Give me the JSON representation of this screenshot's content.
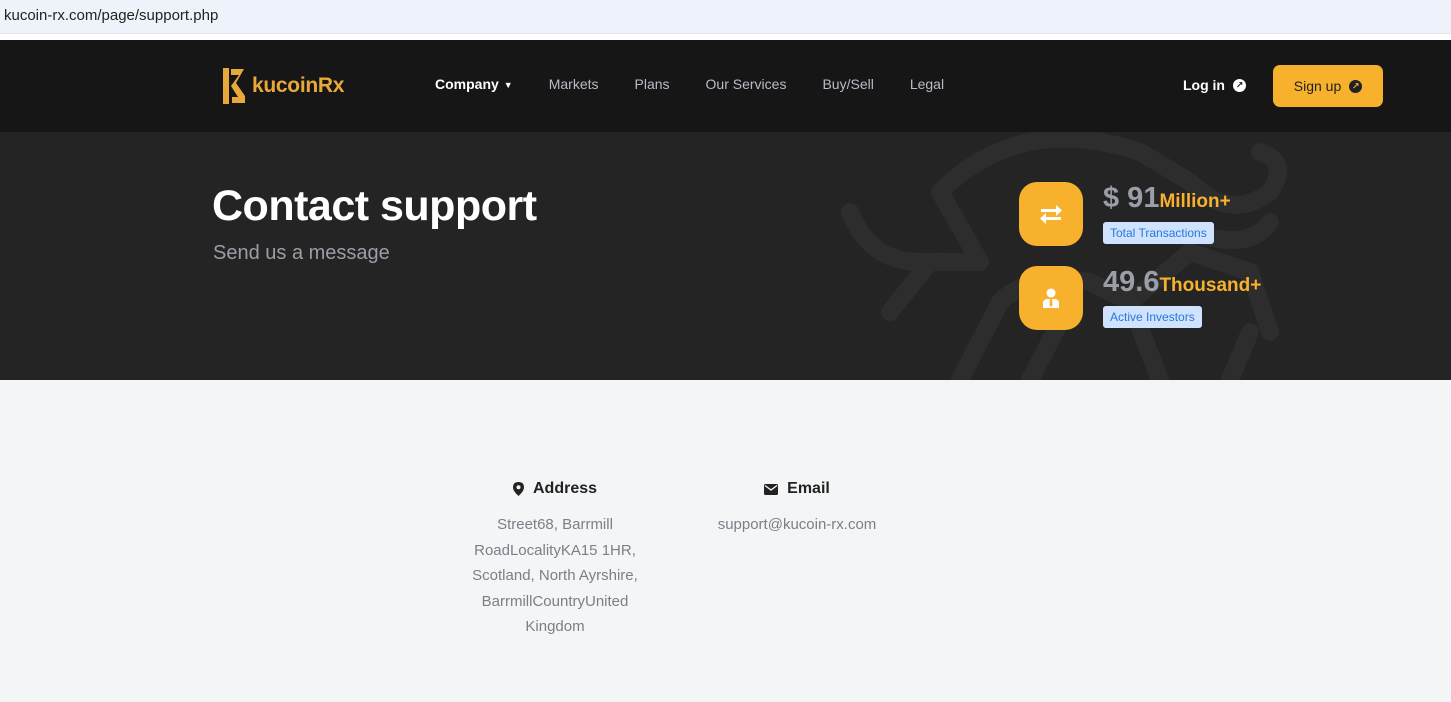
{
  "browser": {
    "url": "kucoin-rx.com/page/support.php"
  },
  "nav": {
    "logo_text": "kucoinRx",
    "brand_color": "#e9a93a",
    "items": [
      {
        "label": "Company",
        "active": true,
        "dropdown": true
      },
      {
        "label": "Markets"
      },
      {
        "label": "Plans"
      },
      {
        "label": "Our Services"
      },
      {
        "label": "Buy/Sell"
      },
      {
        "label": "Legal"
      }
    ],
    "login_label": "Log in",
    "signup_label": "Sign up"
  },
  "hero": {
    "title": "Contact support",
    "subtitle": "Send us a message",
    "stats": [
      {
        "number": "$ 91",
        "unit": "Million+",
        "badge": "Total Transactions",
        "icon": "exchange-arrows-icon"
      },
      {
        "number": "49.6",
        "unit": "Thousand+",
        "badge": "Active Investors",
        "icon": "investor-user-icon"
      }
    ]
  },
  "contact": {
    "address": {
      "heading": "Address",
      "lines": [
        "Street68, Barrmill",
        "RoadLocalityKA15 1HR,",
        "Scotland, North Ayrshire,",
        "BarrmillCountryUnited",
        "Kingdom"
      ]
    },
    "email": {
      "heading": "Email",
      "value": "support@kucoin-rx.com"
    }
  },
  "colors": {
    "accent": "#f8b12c",
    "nav_bg": "#161616",
    "hero_bg": "#242424",
    "badge_bg": "#cfe3ff",
    "badge_text": "#2a76d6"
  }
}
